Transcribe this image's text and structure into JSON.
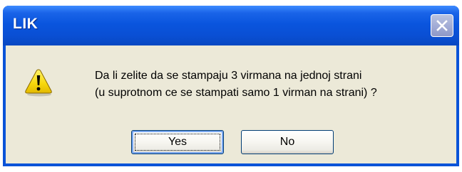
{
  "window": {
    "title": "LIK"
  },
  "dialog": {
    "icon": "warning-icon",
    "message_line1": "Da li zelite da se stampaju 3 virmana na jednoj strani",
    "message_line2": "(u suprotnom ce se stampati samo 1 virman na strani) ?"
  },
  "buttons": {
    "yes_label": "Yes",
    "no_label": "No"
  },
  "colors": {
    "titlebar": "#0a55de",
    "dialog_background": "#ece9d8",
    "warning_yellow": "#f7d80c",
    "close_button_disabled": "#9fa9d4"
  }
}
